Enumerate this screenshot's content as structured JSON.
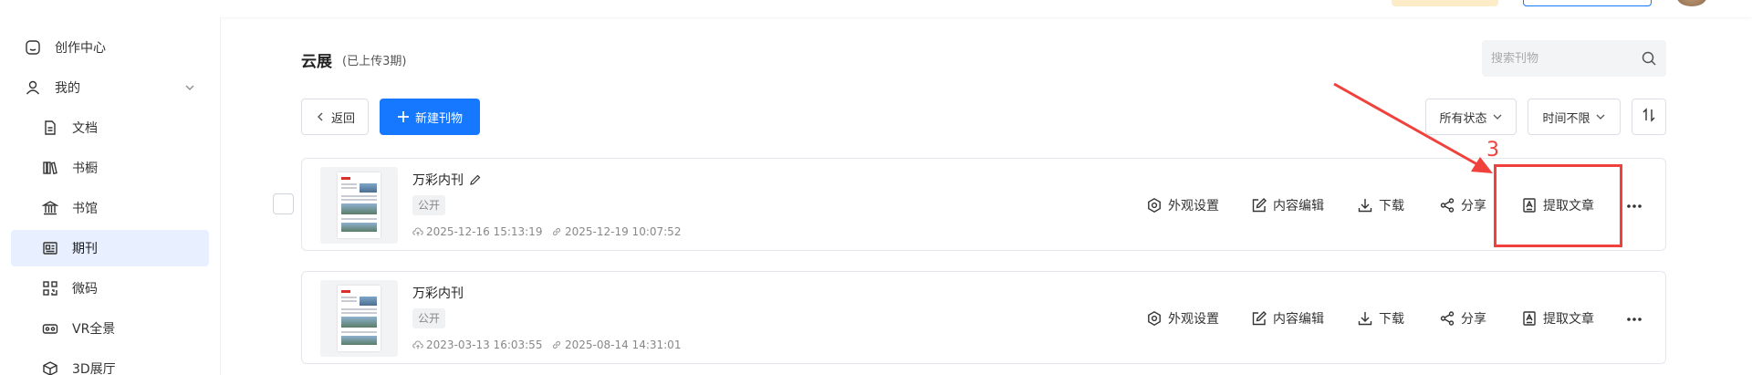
{
  "sidebar": {
    "items": [
      {
        "label": "创作中心",
        "icon": "home-icon"
      },
      {
        "label": "我的",
        "icon": "user-icon"
      },
      {
        "label": "文档",
        "icon": "document-icon"
      },
      {
        "label": "书橱",
        "icon": "bookshelf-icon"
      },
      {
        "label": "书馆",
        "icon": "library-icon"
      },
      {
        "label": "期刊",
        "icon": "journal-icon",
        "active": true
      },
      {
        "label": "微码",
        "icon": "qrcode-icon"
      },
      {
        "label": "VR全景",
        "icon": "vr-icon"
      },
      {
        "label": "3D展厅",
        "icon": "cube-icon"
      }
    ]
  },
  "header": {
    "title": "云展",
    "subtitle": "(已上传3期)"
  },
  "search": {
    "placeholder": "搜索刊物"
  },
  "toolbar": {
    "back_label": "返回",
    "new_label": "新建刊物",
    "status_filter": "所有状态",
    "time_filter": "时间不限"
  },
  "cards": [
    {
      "name": "万彩内刊",
      "badge": "公开",
      "created": "2025-12-16 15:13:19",
      "updated": "2025-12-19 10:07:52"
    },
    {
      "name": "万彩内刊",
      "badge": "公开",
      "created": "2023-03-13 16:03:55",
      "updated": "2025-08-14 14:31:01"
    }
  ],
  "actions": {
    "appearance": "外观设置",
    "content_edit": "内容编辑",
    "download": "下载",
    "share": "分享",
    "extract": "提取文章"
  },
  "annotation": {
    "step_number": "3",
    "color": "#f0413c"
  },
  "colors": {
    "accent": "#1677ff",
    "active_bg": "#e8f0ff"
  }
}
